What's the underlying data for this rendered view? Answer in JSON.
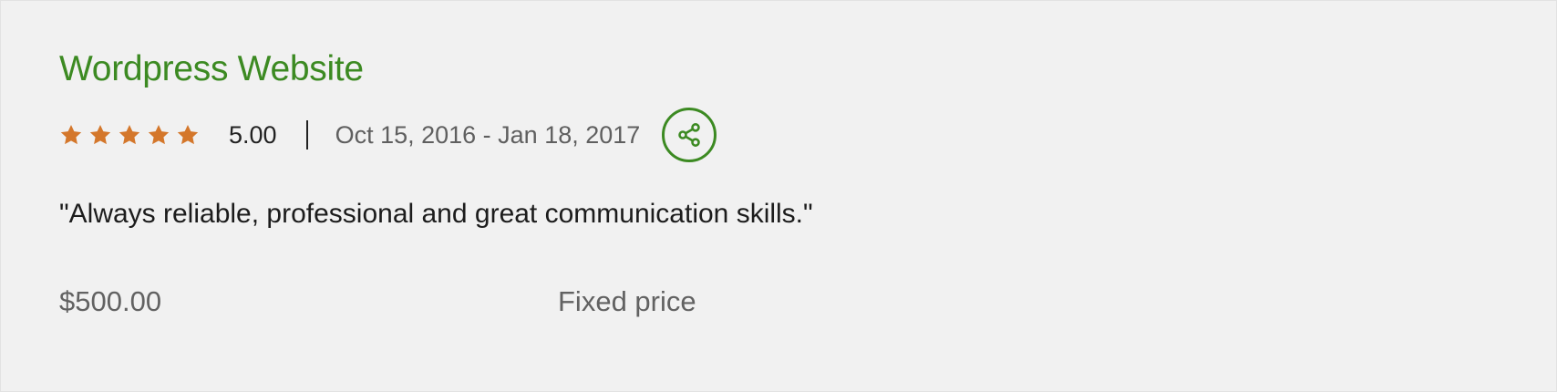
{
  "job": {
    "title": "Wordpress Website",
    "rating": {
      "value": "5.00",
      "stars": 5,
      "max_stars": 5,
      "star_color": "#d4772b"
    },
    "date_range": "Oct 15, 2016 - Jan 18, 2017",
    "share_icon": "share-icon",
    "feedback": "\"Always reliable, professional and great communication skills.\"",
    "price": "$500.00",
    "price_type": "Fixed price"
  },
  "colors": {
    "accent": "#3c8a22",
    "background": "#f1f1f1"
  }
}
